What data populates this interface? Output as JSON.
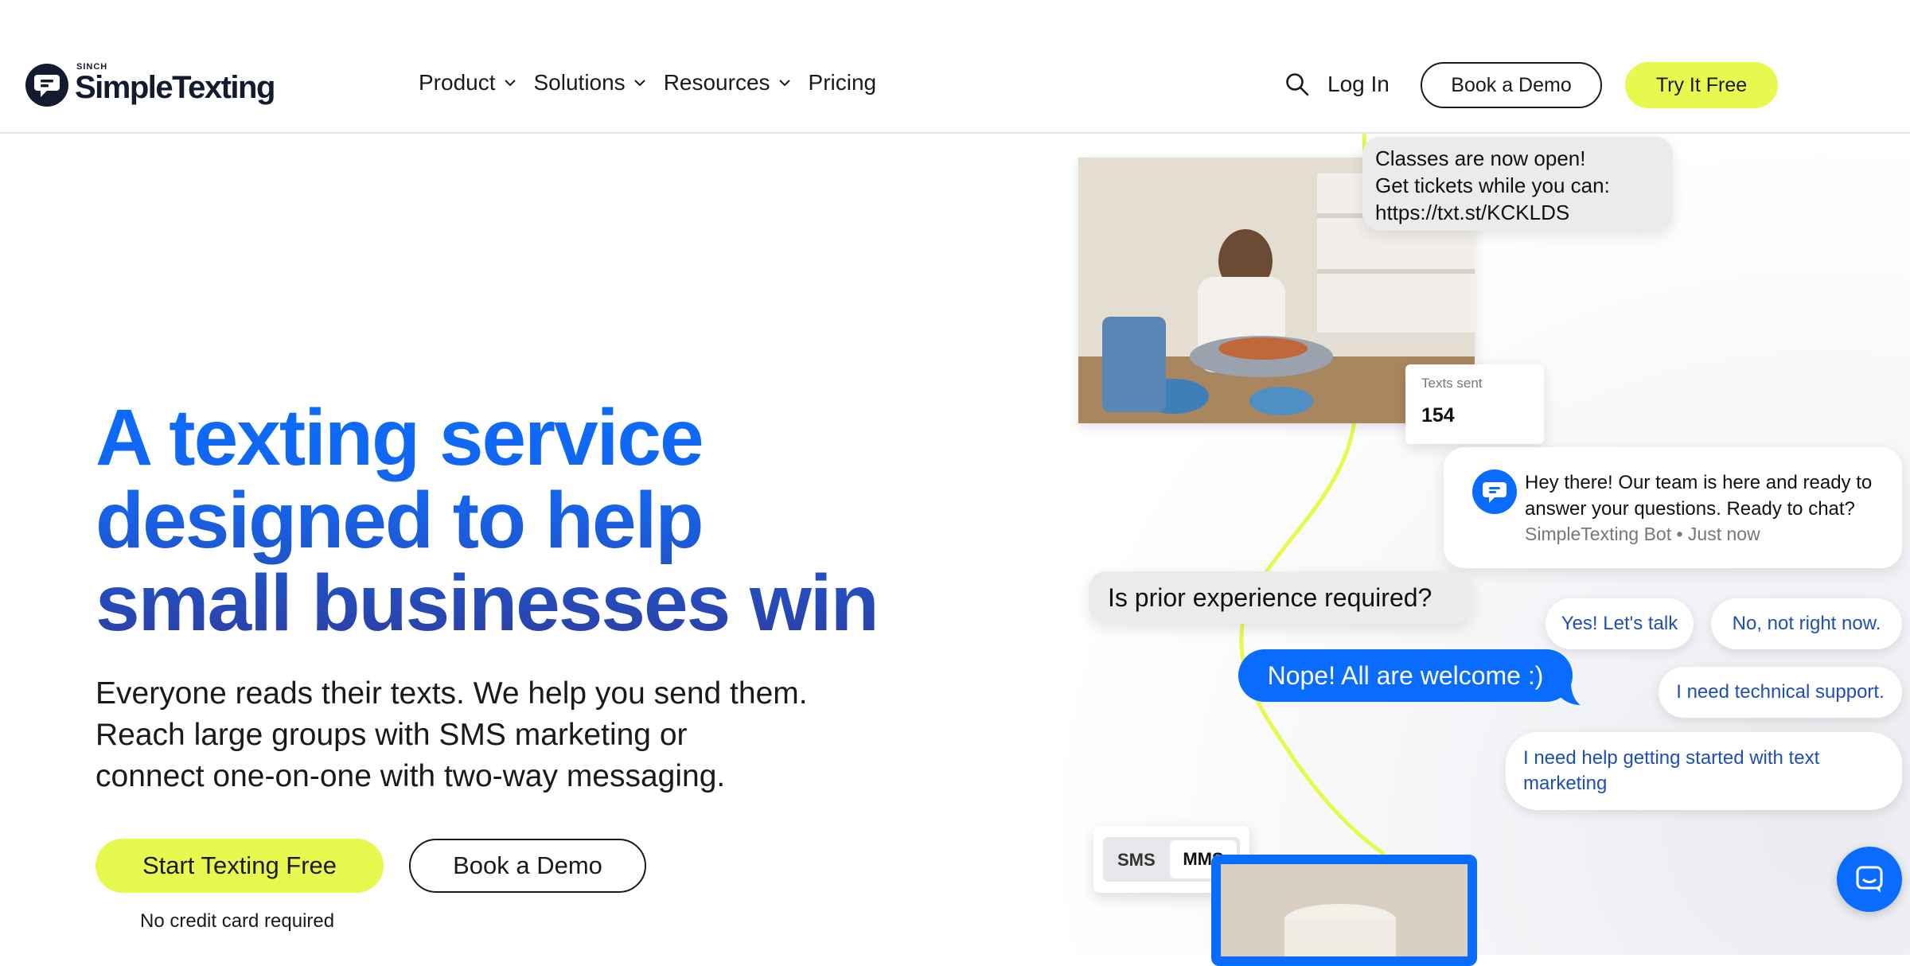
{
  "header": {
    "logo_brand_small": "SINCH",
    "logo_brand": "SimpleTexting",
    "nav": [
      {
        "label": "Product",
        "dropdown": true
      },
      {
        "label": "Solutions",
        "dropdown": true
      },
      {
        "label": "Resources",
        "dropdown": true
      },
      {
        "label": "Pricing",
        "dropdown": false
      }
    ],
    "login_label": "Log In",
    "book_demo_label": "Book a Demo",
    "try_free_label": "Try It Free"
  },
  "hero": {
    "title_line1": "A texting service",
    "title_line2": "designed to help",
    "title_line3": "small businesses win",
    "subtitle_line1": "Everyone reads their texts. We help you send them.",
    "subtitle_line2": "Reach large groups with SMS marketing or",
    "subtitle_line3": "connect one-on-one with two-way messaging.",
    "cta_primary": "Start Texting Free",
    "cta_secondary": "Book a Demo",
    "note": "No credit card required"
  },
  "visual": {
    "classes_bubble": {
      "line1": "Classes are now open!",
      "line2": "Get tickets while you can:",
      "line3": "https://txt.st/KCKLDS"
    },
    "texts_sent": {
      "label": "Texts sent",
      "value": "154"
    },
    "question_bubble": "Is prior experience required?",
    "answer_bubble": "Nope! All are welcome :)",
    "toggle": {
      "option1": "SMS",
      "option2": "MMS",
      "selected": "MMS"
    }
  },
  "chat_widget": {
    "message": "Hey there! Our team is here and ready to answer your questions. Ready to chat?",
    "meta": "SimpleTexting Bot • Just now",
    "replies": [
      "Yes! Let's talk",
      "No, not right now.",
      "I need technical support.",
      "I need help getting started with text marketing"
    ]
  },
  "colors": {
    "accent_yellow": "#e7f84f",
    "brand_blue": "#0a6cff",
    "brand_navy": "#131b2e",
    "title_dark_blue": "#2d3fa3"
  }
}
